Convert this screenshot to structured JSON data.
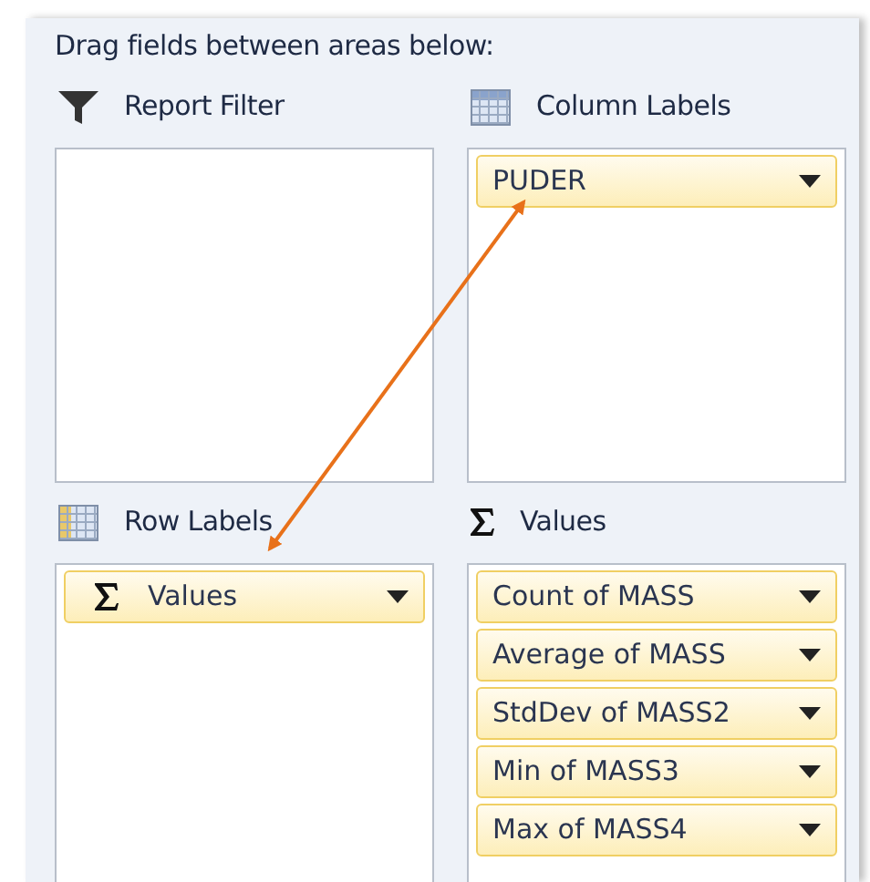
{
  "instruction": "Drag fields between areas below:",
  "areas": [
    {
      "kind": "filter",
      "title": "Report Filter"
    },
    {
      "kind": "columns",
      "title": "Column Labels",
      "fields": [
        {
          "kind": "field",
          "label": "PUDER"
        }
      ]
    },
    {
      "kind": "rows",
      "title": "Row Labels",
      "fields": [
        {
          "kind": "values",
          "label": "Values"
        }
      ]
    },
    {
      "kind": "values",
      "title": "Values",
      "fields": [
        {
          "kind": "field",
          "label": "Count of MASS"
        },
        {
          "kind": "field",
          "label": "Average of MASS"
        },
        {
          "kind": "field",
          "label": "StdDev of MASS2"
        },
        {
          "kind": "field",
          "label": "Min of MASS3"
        },
        {
          "kind": "field",
          "label": "Max of MASS4"
        }
      ]
    }
  ]
}
